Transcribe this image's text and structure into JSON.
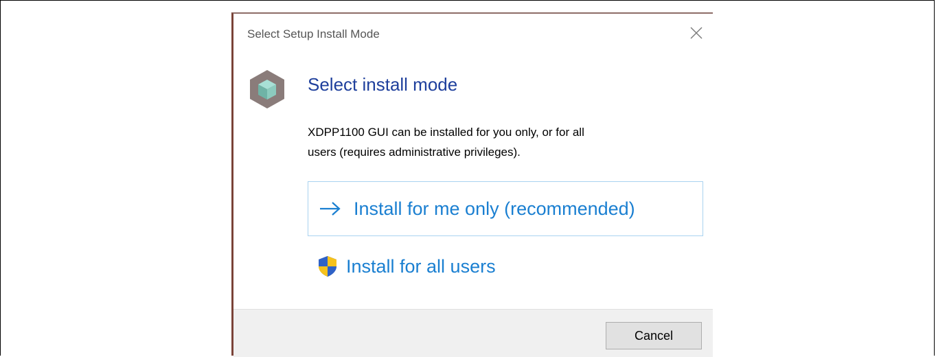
{
  "window": {
    "title": "Select Setup Install Mode",
    "close_icon": "close-icon"
  },
  "content": {
    "app_icon": "package-box-icon",
    "heading": "Select install mode",
    "description_line1": "XDPP1100 GUI can be installed for you only, or for all",
    "description_line2": "users (requires administrative privileges)."
  },
  "options": {
    "primary": {
      "icon": "arrow-right-icon",
      "label": "Install for me only (recommended)"
    },
    "secondary": {
      "icon": "uac-shield-icon",
      "label": "Install for all users"
    }
  },
  "footer": {
    "cancel_label": "Cancel"
  },
  "colors": {
    "heading": "#1e3f9c",
    "link": "#1a7fd1",
    "primary_option_border": "#a9d2f0",
    "footer_background": "#f0f0f0"
  }
}
